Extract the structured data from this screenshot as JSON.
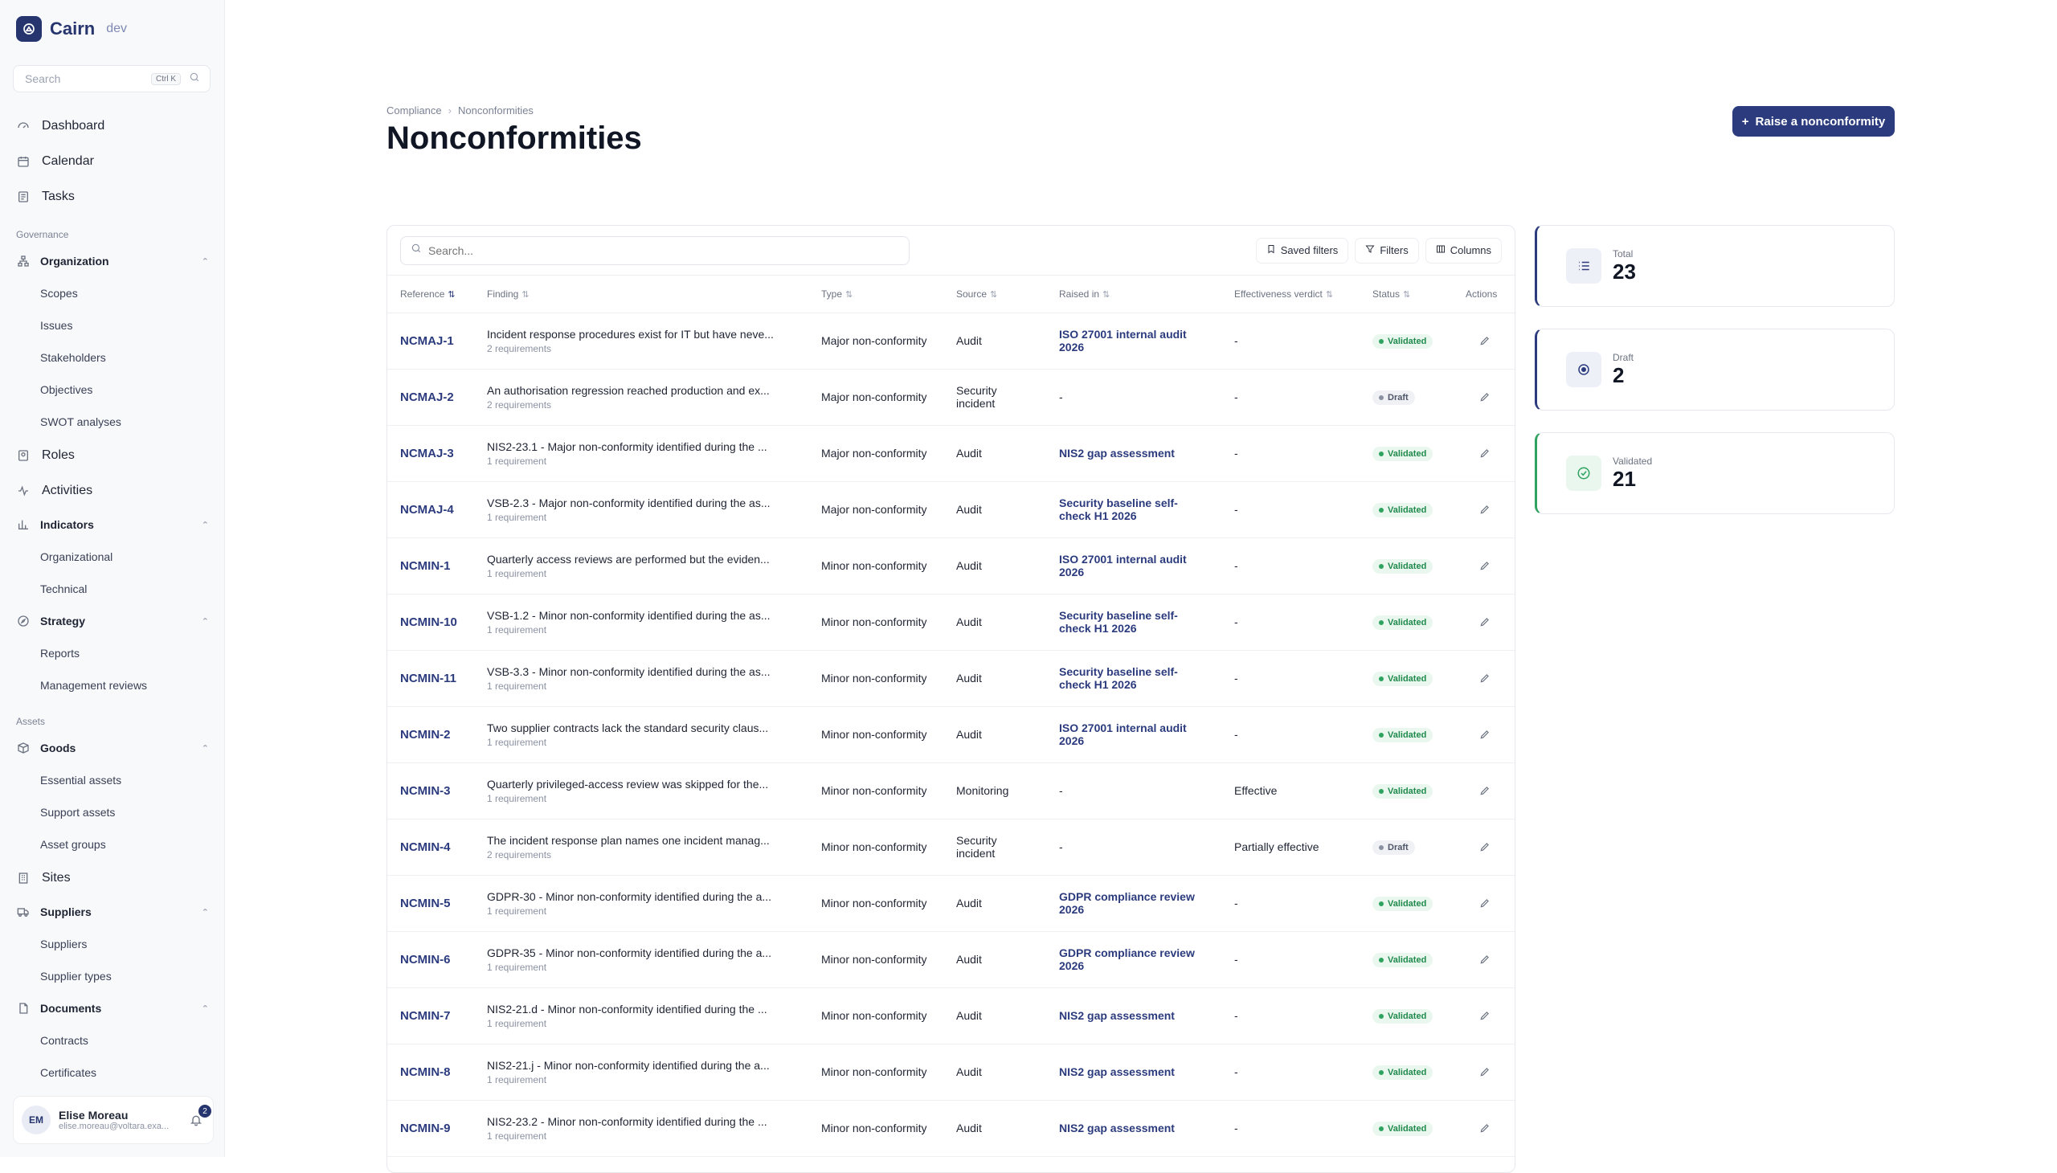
{
  "brand": {
    "name": "Cairn",
    "env": "dev"
  },
  "sidebar": {
    "search_placeholder": "Search",
    "search_shortcut": "Ctrl K",
    "top_items": [
      {
        "label": "Dashboard",
        "icon": "dashboard-icon"
      },
      {
        "label": "Calendar",
        "icon": "calendar-icon"
      },
      {
        "label": "Tasks",
        "icon": "tasks-icon"
      }
    ],
    "governance_title": "Governance",
    "organization": {
      "label": "Organization",
      "children": [
        "Scopes",
        "Issues",
        "Stakeholders",
        "Objectives",
        "SWOT analyses"
      ]
    },
    "roles": "Roles",
    "activities": "Activities",
    "indicators": {
      "label": "Indicators",
      "children": [
        "Organizational",
        "Technical"
      ]
    },
    "strategy": {
      "label": "Strategy",
      "children": [
        "Reports",
        "Management reviews"
      ]
    },
    "assets_title": "Assets",
    "goods": {
      "label": "Goods",
      "children": [
        "Essential assets",
        "Support assets",
        "Asset groups"
      ]
    },
    "sites": "Sites",
    "suppliers": {
      "label": "Suppliers",
      "children": [
        "Suppliers",
        "Supplier types"
      ]
    },
    "documents": {
      "label": "Documents",
      "children": [
        "Contracts",
        "Certificates"
      ]
    }
  },
  "user": {
    "initials": "EM",
    "name": "Elise Moreau",
    "email": "elise.moreau@voltara.exa...",
    "notifications": "2"
  },
  "breadcrumb": {
    "parent": "Compliance",
    "current": "Nonconformities"
  },
  "page_title": "Nonconformities",
  "primary_action": "Raise a nonconformity",
  "toolbar": {
    "search_placeholder": "Search...",
    "saved_filters": "Saved filters",
    "filters": "Filters",
    "columns": "Columns"
  },
  "columns": [
    "Reference",
    "Finding",
    "Type",
    "Source",
    "Raised in",
    "Effectiveness verdict",
    "Status",
    "Actions"
  ],
  "rows": [
    {
      "ref": "NCMAJ-1",
      "finding": "Incident response procedures exist for IT but have neve...",
      "req": "2 requirements",
      "type": "Major non-conformity",
      "source": "Audit",
      "raised": "ISO 27001 internal audit 2026",
      "verdict": "-",
      "status": "Validated"
    },
    {
      "ref": "NCMAJ-2",
      "finding": "An authorisation regression reached production and ex...",
      "req": "2 requirements",
      "type": "Major non-conformity",
      "source": "Security incident",
      "raised": "-",
      "verdict": "-",
      "status": "Draft"
    },
    {
      "ref": "NCMAJ-3",
      "finding": "NIS2-23.1 - Major non-conformity identified during the ...",
      "req": "1 requirement",
      "type": "Major non-conformity",
      "source": "Audit",
      "raised": "NIS2 gap assessment",
      "verdict": "-",
      "status": "Validated"
    },
    {
      "ref": "NCMAJ-4",
      "finding": "VSB-2.3 - Major non-conformity identified during the as...",
      "req": "1 requirement",
      "type": "Major non-conformity",
      "source": "Audit",
      "raised": "Security baseline self-check H1 2026",
      "verdict": "-",
      "status": "Validated"
    },
    {
      "ref": "NCMIN-1",
      "finding": "Quarterly access reviews are performed but the eviden...",
      "req": "1 requirement",
      "type": "Minor non-conformity",
      "source": "Audit",
      "raised": "ISO 27001 internal audit 2026",
      "verdict": "-",
      "status": "Validated"
    },
    {
      "ref": "NCMIN-10",
      "finding": "VSB-1.2 - Minor non-conformity identified during the as...",
      "req": "1 requirement",
      "type": "Minor non-conformity",
      "source": "Audit",
      "raised": "Security baseline self-check H1 2026",
      "verdict": "-",
      "status": "Validated"
    },
    {
      "ref": "NCMIN-11",
      "finding": "VSB-3.3 - Minor non-conformity identified during the as...",
      "req": "1 requirement",
      "type": "Minor non-conformity",
      "source": "Audit",
      "raised": "Security baseline self-check H1 2026",
      "verdict": "-",
      "status": "Validated"
    },
    {
      "ref": "NCMIN-2",
      "finding": "Two supplier contracts lack the standard security claus...",
      "req": "1 requirement",
      "type": "Minor non-conformity",
      "source": "Audit",
      "raised": "ISO 27001 internal audit 2026",
      "verdict": "-",
      "status": "Validated"
    },
    {
      "ref": "NCMIN-3",
      "finding": "Quarterly privileged-access review was skipped for the...",
      "req": "1 requirement",
      "type": "Minor non-conformity",
      "source": "Monitoring",
      "raised": "-",
      "verdict": "Effective",
      "status": "Validated"
    },
    {
      "ref": "NCMIN-4",
      "finding": "The incident response plan names one incident manag...",
      "req": "2 requirements",
      "type": "Minor non-conformity",
      "source": "Security incident",
      "raised": "-",
      "verdict": "Partially effective",
      "status": "Draft"
    },
    {
      "ref": "NCMIN-5",
      "finding": "GDPR-30 - Minor non-conformity identified during the a...",
      "req": "1 requirement",
      "type": "Minor non-conformity",
      "source": "Audit",
      "raised": "GDPR compliance review 2026",
      "verdict": "-",
      "status": "Validated"
    },
    {
      "ref": "NCMIN-6",
      "finding": "GDPR-35 - Minor non-conformity identified during the a...",
      "req": "1 requirement",
      "type": "Minor non-conformity",
      "source": "Audit",
      "raised": "GDPR compliance review 2026",
      "verdict": "-",
      "status": "Validated"
    },
    {
      "ref": "NCMIN-7",
      "finding": "NIS2-21.d - Minor non-conformity identified during the ...",
      "req": "1 requirement",
      "type": "Minor non-conformity",
      "source": "Audit",
      "raised": "NIS2 gap assessment",
      "verdict": "-",
      "status": "Validated"
    },
    {
      "ref": "NCMIN-8",
      "finding": "NIS2-21.j - Minor non-conformity identified during the a...",
      "req": "1 requirement",
      "type": "Minor non-conformity",
      "source": "Audit",
      "raised": "NIS2 gap assessment",
      "verdict": "-",
      "status": "Validated"
    },
    {
      "ref": "NCMIN-9",
      "finding": "NIS2-23.2 - Minor non-conformity identified during the ...",
      "req": "1 requirement",
      "type": "Minor non-conformity",
      "source": "Audit",
      "raised": "NIS2 gap assessment",
      "verdict": "-",
      "status": "Validated"
    }
  ],
  "stats": [
    {
      "key": "total",
      "label": "Total",
      "value": "23",
      "icon": "list-icon"
    },
    {
      "key": "draft",
      "label": "Draft",
      "value": "2",
      "icon": "target-icon"
    },
    {
      "key": "validated",
      "label": "Validated",
      "value": "21",
      "icon": "check-circle-icon"
    }
  ],
  "colors": {
    "primary": "#2b3b7d",
    "success": "#2ea35f"
  }
}
